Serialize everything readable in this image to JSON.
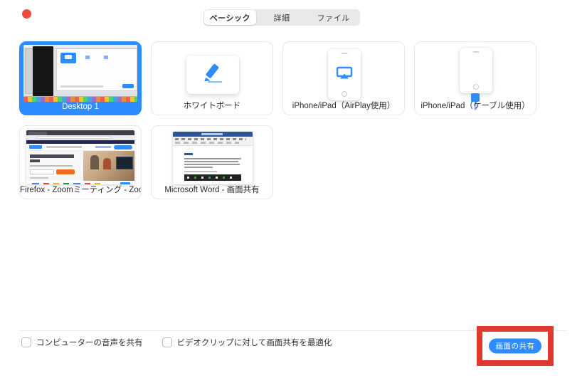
{
  "window": {
    "close_dot": "window close control"
  },
  "tabs": {
    "items": [
      {
        "label": "ベーシック",
        "selected": true
      },
      {
        "label": "詳細",
        "selected": false
      },
      {
        "label": "ファイル",
        "selected": false
      }
    ]
  },
  "tiles": {
    "desktop": {
      "label": "Desktop 1",
      "selected": true
    },
    "whiteboard": {
      "label": "ホワイトボード",
      "icon": "pencil-icon"
    },
    "airplay": {
      "label": "iPhone/iPad（AirPlay使用）",
      "icon": "airplay-icon"
    },
    "cable": {
      "label": "iPhone/iPad（ケーブル使用）",
      "icon": "cable-icon"
    },
    "firefox": {
      "label": "Firefox - Zoomミーティング - Zoom..."
    },
    "word": {
      "label": "Microsoft Word - 画面共有"
    }
  },
  "footer": {
    "checkboxes": [
      {
        "label": "コンピューターの音声を共有",
        "checked": false
      },
      {
        "label": "ビデオクリップに対して画面共有を最適化",
        "checked": false
      }
    ],
    "share_button_label": "画面の共有"
  },
  "colors": {
    "accent_blue": "#2D8CFF",
    "annotation_red": "#E0392E",
    "close_dot_red": "#EE4B40"
  }
}
